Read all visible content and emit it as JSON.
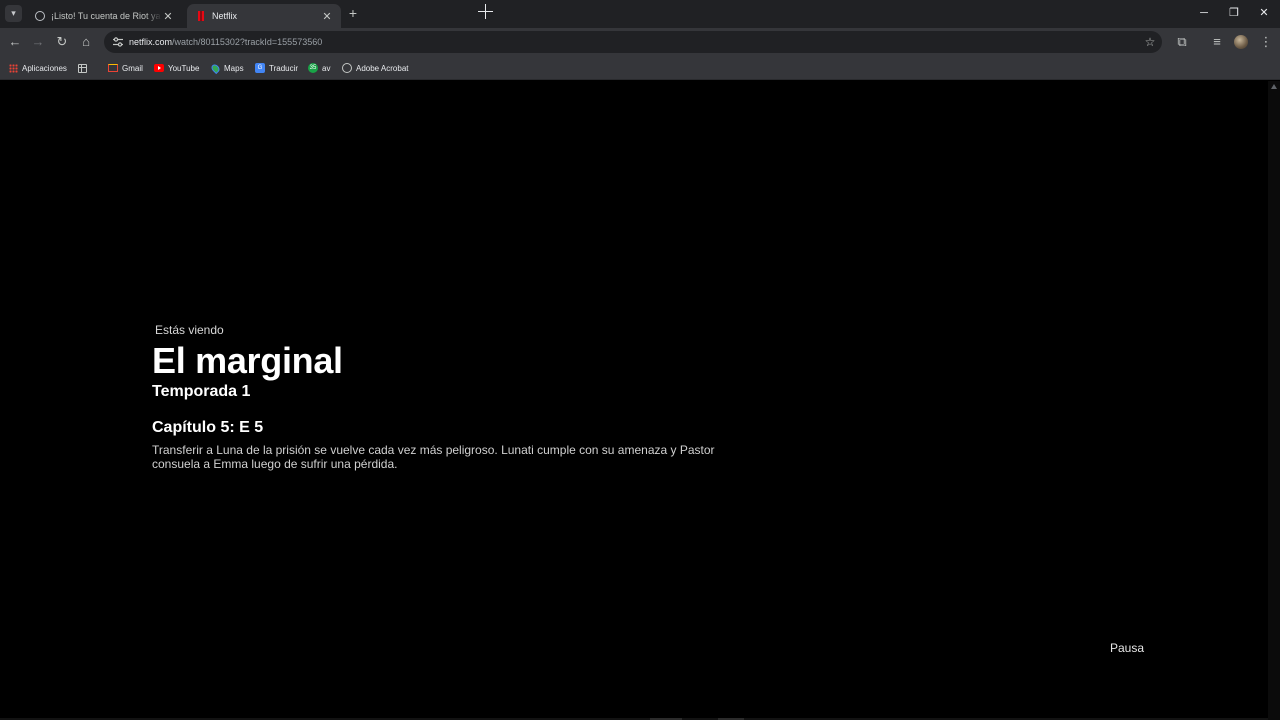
{
  "browser": {
    "tabs": [
      {
        "title": "¡Listo! Tu cuenta de Riot ya está",
        "favicon": "globe-icon",
        "active": false
      },
      {
        "title": "Netflix",
        "favicon": "netflix-icon",
        "active": true
      }
    ],
    "address": {
      "host": "netflix.com",
      "path": "/watch/80115302?trackId=155573560"
    },
    "bookmarks": [
      {
        "label": "Aplicaciones",
        "icon": "apps-grid-icon"
      },
      {
        "label": "",
        "icon": "tab-groups-icon"
      },
      {
        "label": "Gmail",
        "icon": "gmail-icon"
      },
      {
        "label": "YouTube",
        "icon": "youtube-icon"
      },
      {
        "label": "Maps",
        "icon": "maps-icon"
      },
      {
        "label": "Traducir",
        "icon": "translate-icon"
      },
      {
        "label": "av",
        "icon": "av-icon",
        "badge": "35"
      },
      {
        "label": "Adobe Acrobat",
        "icon": "acrobat-icon"
      }
    ]
  },
  "player": {
    "watching_label": "Estás viendo",
    "show_title": "El marginal",
    "season": "Temporada 1",
    "episode": "Capítulo 5: E 5",
    "synopsis": "Transferir a Luna de la prisión se vuelve cada vez más peligroso. Lunati cumple con su amenaza y Pastor consuela a Emma luego de sufrir una pérdida.",
    "pause_label": "Pausa"
  },
  "colors": {
    "netflix_red": "#e50914",
    "page_background": "#000000",
    "chrome_tabstrip": "#202124",
    "chrome_toolbar": "#35363a"
  }
}
